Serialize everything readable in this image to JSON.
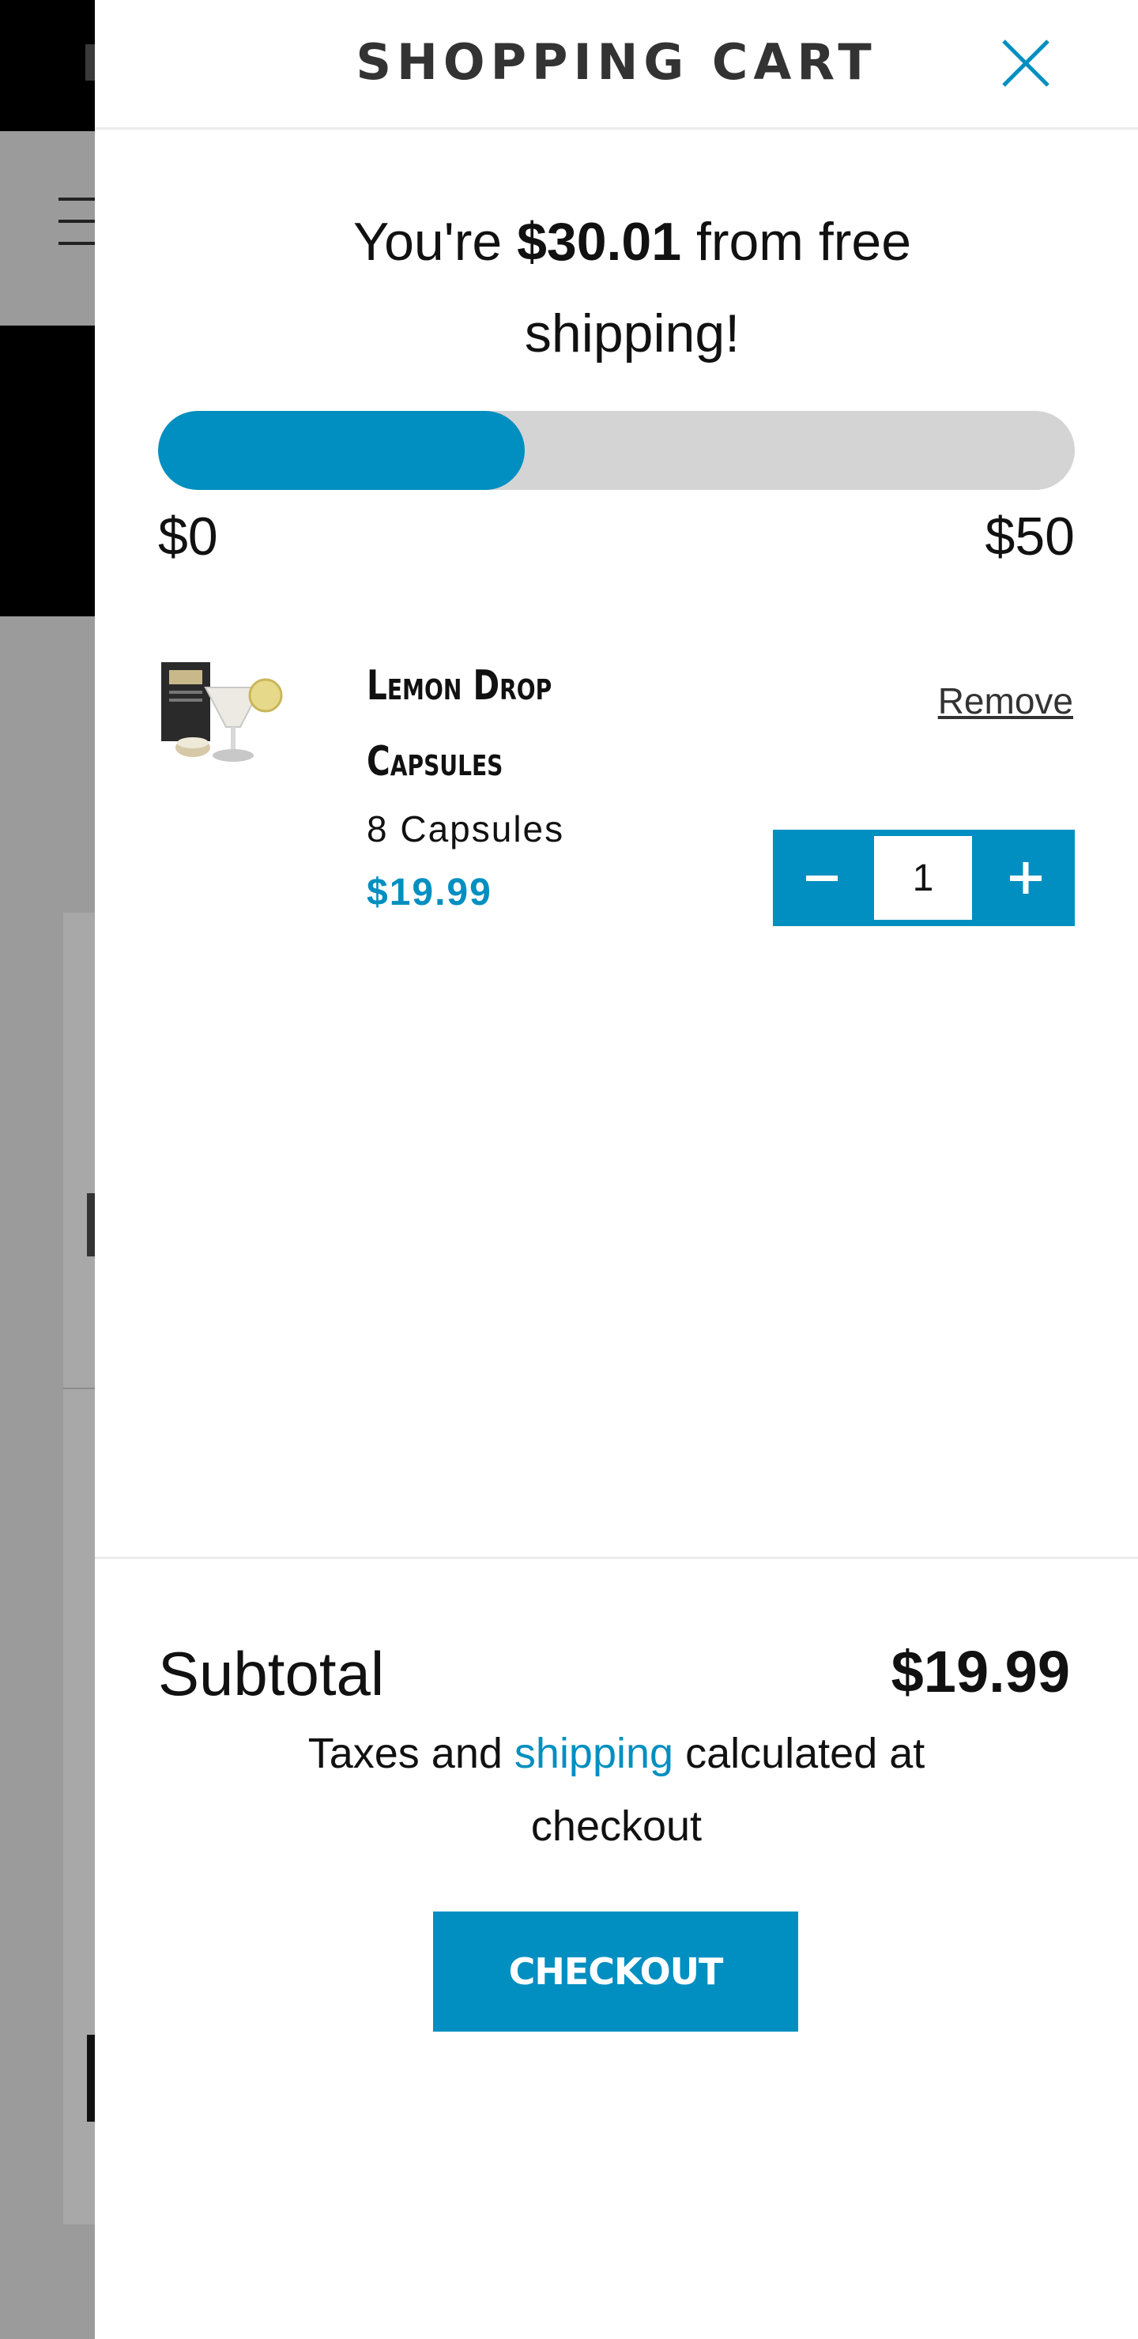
{
  "drawer": {
    "title": "SHOPPING CART",
    "close_icon": "close-icon"
  },
  "free_shipping": {
    "prefix": "You're ",
    "amount": "$30.01",
    "suffix": " from free shipping!",
    "progress_fraction": 0.4,
    "min_label": "$0",
    "max_label": "$50"
  },
  "cart": {
    "items": [
      {
        "name": "Lemon Drop Capsules",
        "variant": "8 Capsules",
        "price": "$19.99",
        "remove_label": "Remove",
        "quantity": "1",
        "minus_icon": "minus-icon",
        "plus_icon": "plus-icon"
      }
    ]
  },
  "footer": {
    "subtotal_label": "Subtotal",
    "subtotal_value": "$19.99",
    "tax_prefix": "Taxes and ",
    "tax_link": "shipping",
    "tax_suffix": " calculated at checkout",
    "checkout_label": "CHECKOUT"
  },
  "colors": {
    "accent": "#008fc0",
    "progress_track": "#d4d4d4",
    "overlay": "#9b9b9b"
  }
}
